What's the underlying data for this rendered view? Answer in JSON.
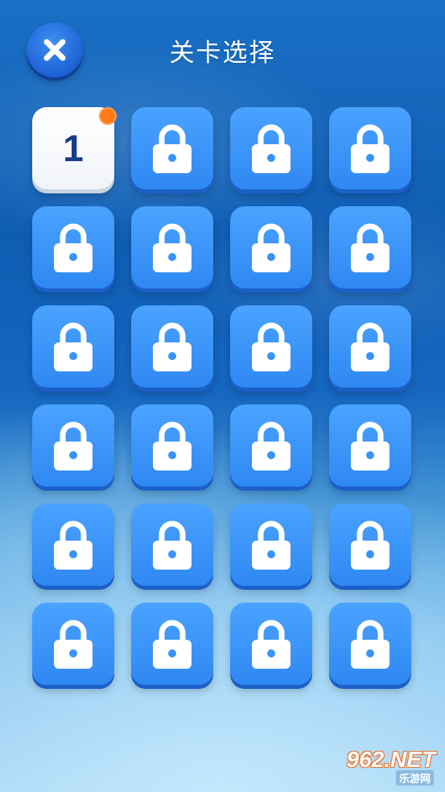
{
  "header": {
    "title": "关卡选择",
    "close_icon": "close-icon"
  },
  "levels": [
    {
      "label": "1",
      "state": "unlocked",
      "has_badge": true
    },
    {
      "state": "locked"
    },
    {
      "state": "locked"
    },
    {
      "state": "locked"
    },
    {
      "state": "locked"
    },
    {
      "state": "locked"
    },
    {
      "state": "locked"
    },
    {
      "state": "locked"
    },
    {
      "state": "locked"
    },
    {
      "state": "locked"
    },
    {
      "state": "locked"
    },
    {
      "state": "locked"
    },
    {
      "state": "locked"
    },
    {
      "state": "locked"
    },
    {
      "state": "locked"
    },
    {
      "state": "locked"
    },
    {
      "state": "locked"
    },
    {
      "state": "locked"
    },
    {
      "state": "locked"
    },
    {
      "state": "locked"
    },
    {
      "state": "locked"
    },
    {
      "state": "locked"
    },
    {
      "state": "locked"
    },
    {
      "state": "locked"
    }
  ],
  "watermark": {
    "main": "962.NET",
    "sub": "乐游网"
  },
  "colors": {
    "tile_blue": "#3a93f8",
    "badge_orange": "#ff7a1a",
    "level_number": "#163c8c"
  }
}
